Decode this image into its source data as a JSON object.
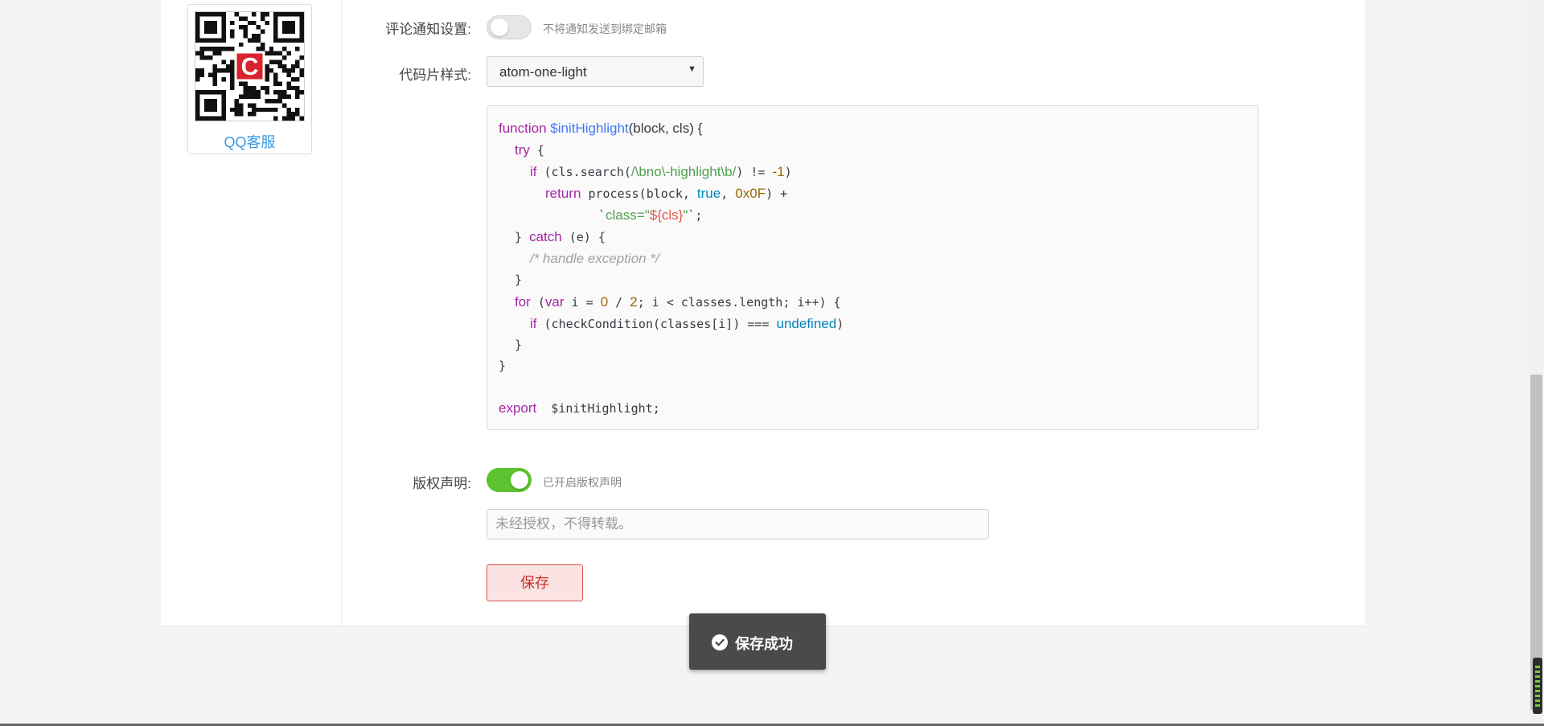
{
  "sidebar": {
    "qr_label": "QQ客服",
    "qr_logo_letter": "C"
  },
  "settings": {
    "comment_notify": {
      "label": "评论通知设置:",
      "enabled": false,
      "hint": "不将通知发送到绑定邮箱"
    },
    "code_style": {
      "label": "代码片样式:",
      "selected": "atom-one-light"
    },
    "copyright": {
      "label": "版权声明:",
      "enabled": true,
      "hint": "已开启版权声明",
      "text_placeholder": "未经授权，不得转载。"
    },
    "save_label": "保存"
  },
  "code_preview": {
    "l1_kw": "function",
    "l1_fn": "$initHighlight",
    "l1_rest": "(block, cls) {",
    "l2_kw": "try",
    "l2_rest": " {",
    "l3_kw": "if",
    "l3_a": " (cls.search(",
    "l3_re": "/\\bno\\-highlight\\b/",
    "l3_b": ") != ",
    "l3_num": "-1",
    "l3_c": ")",
    "l4_kw": "return",
    "l4_a": " process(block, ",
    "l4_lit": "true",
    "l4_b": ", ",
    "l4_num": "0x0F",
    "l4_c": ") +",
    "l5_a": "`",
    "l5_str": "class=\"",
    "l5_tpl": "${cls}",
    "l5_str2": "\"",
    "l5_b": "`;",
    "l6_a": "} ",
    "l6_kw": "catch",
    "l6_b": " (e) {",
    "l7_cmt": "/* handle exception */",
    "l8": "}",
    "l9_kw": "for",
    "l9_a": " (",
    "l9_kw2": "var",
    "l9_b": " i = ",
    "l9_n1": "0",
    "l9_c": " / ",
    "l9_n2": "2",
    "l9_d": "; i < classes.length; i++) {",
    "l10_kw": "if",
    "l10_a": " (checkCondition(classes[i]) === ",
    "l10_lit": "undefined",
    "l10_b": ")",
    "l11": "}",
    "l12": "}",
    "l13_kw": "export",
    "l13_a": "  $initHighlight;"
  },
  "toast": {
    "message": "保存成功"
  }
}
